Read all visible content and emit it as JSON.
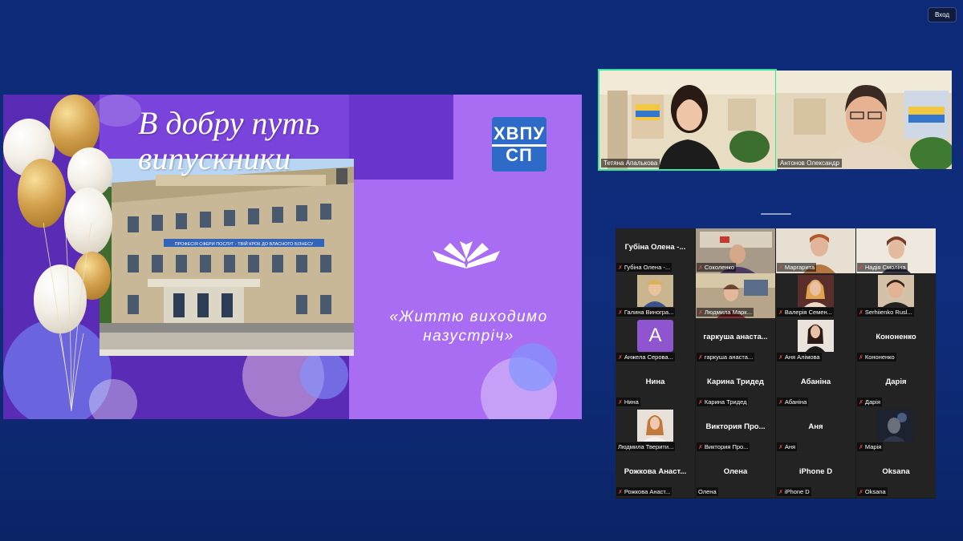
{
  "window": {
    "top_button_label": "Вход"
  },
  "slide": {
    "title_line1": "В добру путь",
    "title_line2": "випускники",
    "logo_line1": "ХВПУ",
    "logo_line2": "СП",
    "motto_line1": "«Життю виходимо",
    "motto_line2": "назустріч»",
    "building_banner": "ПРОФЕСІЯ СФЕРИ ПОСЛУГ - ТВІЙ КРОК ДО ВЛАСНОГО БІЗНЕСУ"
  },
  "speakers": [
    {
      "name": "Тетяна Апалькова",
      "active": true
    },
    {
      "name": "Антонов Олександр",
      "active": false
    }
  ],
  "gallery": [
    {
      "big": "Губіна Олена -...",
      "small": "Губіна Олена -...",
      "video": false
    },
    {
      "big": "",
      "small": "Соколенко",
      "video": true
    },
    {
      "big": "",
      "small": "Маргарита",
      "video": true
    },
    {
      "big": "",
      "small": "Надія Смоліна",
      "video": true
    },
    {
      "big": "",
      "small": "Галина Виногра...",
      "video": true
    },
    {
      "big": "",
      "small": "Людмила Марк...",
      "video": true
    },
    {
      "big": "",
      "small": "Валерія Семен...",
      "video": true
    },
    {
      "big": "",
      "small": "Serhiienko Rusl...",
      "video": true
    },
    {
      "big": "",
      "small": "Анжела Серова...",
      "avatar": "A"
    },
    {
      "big": "гаркуша анаста...",
      "small": "гаркуша анаста...",
      "video": false
    },
    {
      "big": "",
      "small": "Аня Алімова",
      "video": true
    },
    {
      "big": "Кононенко",
      "small": "Кононенко",
      "video": false
    },
    {
      "big": "Нина",
      "small": "Нина",
      "video": false
    },
    {
      "big": "Карина Тридед",
      "small": "Карина Тридед",
      "video": false
    },
    {
      "big": "Абаніна",
      "small": "Абаніна",
      "video": false
    },
    {
      "big": "Дарія",
      "small": "Дарія",
      "video": false
    },
    {
      "big": "",
      "small": "Людмила Тверити...",
      "video": true
    },
    {
      "big": "Виктория Про...",
      "small": "Виктория Про...",
      "video": false
    },
    {
      "big": "Аня",
      "small": "Аня",
      "video": false
    },
    {
      "big": "",
      "small": "Марія",
      "video": true
    },
    {
      "big": "Рожкова Анаст...",
      "small": "Рожкова Анаст...",
      "video": false
    },
    {
      "big": "Олена",
      "small": "Олена",
      "video": false,
      "nomic": true
    },
    {
      "big": "iPhone D",
      "small": "iPhone D",
      "video": false
    },
    {
      "big": "Oksana",
      "small": "Oksana",
      "video": false
    }
  ],
  "colors": {
    "active_speaker": "#39e6a0",
    "muted_mic": "#e24a4a",
    "background": "#0f2d7c"
  }
}
